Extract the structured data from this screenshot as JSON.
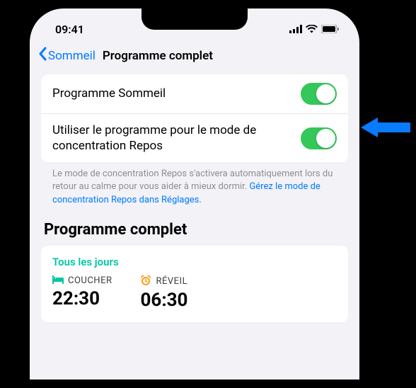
{
  "status": {
    "time": "09:41"
  },
  "nav": {
    "back_label": "Sommeil",
    "title": "Programme complet"
  },
  "toggles": {
    "sleep_program_label": "Programme Sommeil",
    "use_focus_label": "Utiliser le programme pour le mode de concentration Repos"
  },
  "footer": {
    "text": "Le mode de concentration Repos s'activera automatiquement lors du retour au calme pour vous aider à mieux dormir. ",
    "link": "Gérez le mode de concentration Repos dans Réglages."
  },
  "section": {
    "title": "Programme complet"
  },
  "schedule": {
    "days": "Tous les jours",
    "bed_label": "COUCHER",
    "bed_time": "22:30",
    "wake_label": "RÉVEIL",
    "wake_time": "06:30"
  }
}
